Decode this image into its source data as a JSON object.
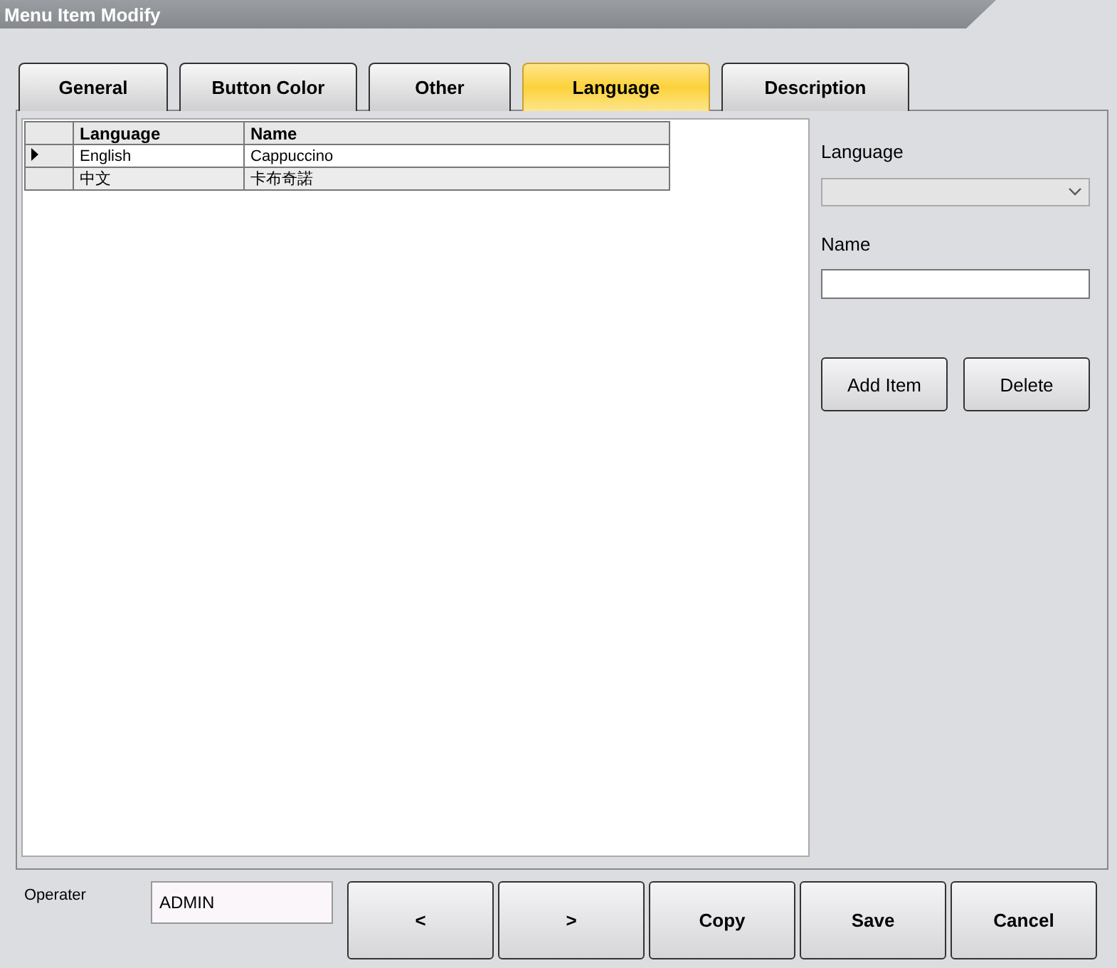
{
  "window": {
    "title": "Menu Item Modify"
  },
  "tabs": [
    {
      "label": "General",
      "selected": false
    },
    {
      "label": "Button Color",
      "selected": false
    },
    {
      "label": "Other",
      "selected": false
    },
    {
      "label": "Language",
      "selected": true
    },
    {
      "label": "Description",
      "selected": false
    }
  ],
  "table": {
    "columns": [
      "Language",
      "Name"
    ],
    "rows": [
      {
        "cells": [
          "English",
          "Cappuccino"
        ],
        "selected": true
      },
      {
        "cells": [
          "中文",
          "卡布奇諾"
        ],
        "selected": false
      }
    ]
  },
  "form": {
    "language_label": "Language",
    "language_disabled": true,
    "name_label": "Name",
    "buttons": [
      "Add Item",
      "Delete"
    ]
  },
  "footer": {
    "operator_label": "Operater",
    "operator_value": "ADMIN",
    "buttons": [
      "<",
      ">",
      "Copy",
      "Save",
      "Cancel"
    ]
  }
}
